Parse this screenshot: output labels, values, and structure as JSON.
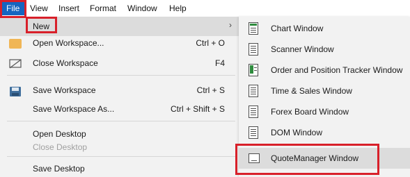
{
  "menubar": {
    "items": [
      "File",
      "View",
      "Insert",
      "Format",
      "Window",
      "Help"
    ]
  },
  "file_menu": {
    "new": "New",
    "open_workspace": "Open Workspace...",
    "open_workspace_shortcut": "Ctrl + O",
    "close_workspace": "Close Workspace",
    "close_workspace_shortcut": "F4",
    "save_workspace": "Save Workspace",
    "save_workspace_shortcut": "Ctrl + S",
    "save_workspace_as": "Save Workspace As...",
    "save_workspace_as_shortcut": "Ctrl + Shift + S",
    "open_desktop": "Open Desktop",
    "close_desktop": "Close Desktop",
    "save_desktop": "Save Desktop"
  },
  "new_submenu": {
    "items": [
      "Chart Window",
      "Scanner Window",
      "Order and Position Tracker Window",
      "Time & Sales Window",
      "Forex Board Window",
      "DOM Window",
      "QuoteManager Window"
    ]
  },
  "colors": {
    "file_active_bg": "#1565c0",
    "highlight_box": "#d8202a",
    "menu_bg": "#f2f2f2"
  }
}
